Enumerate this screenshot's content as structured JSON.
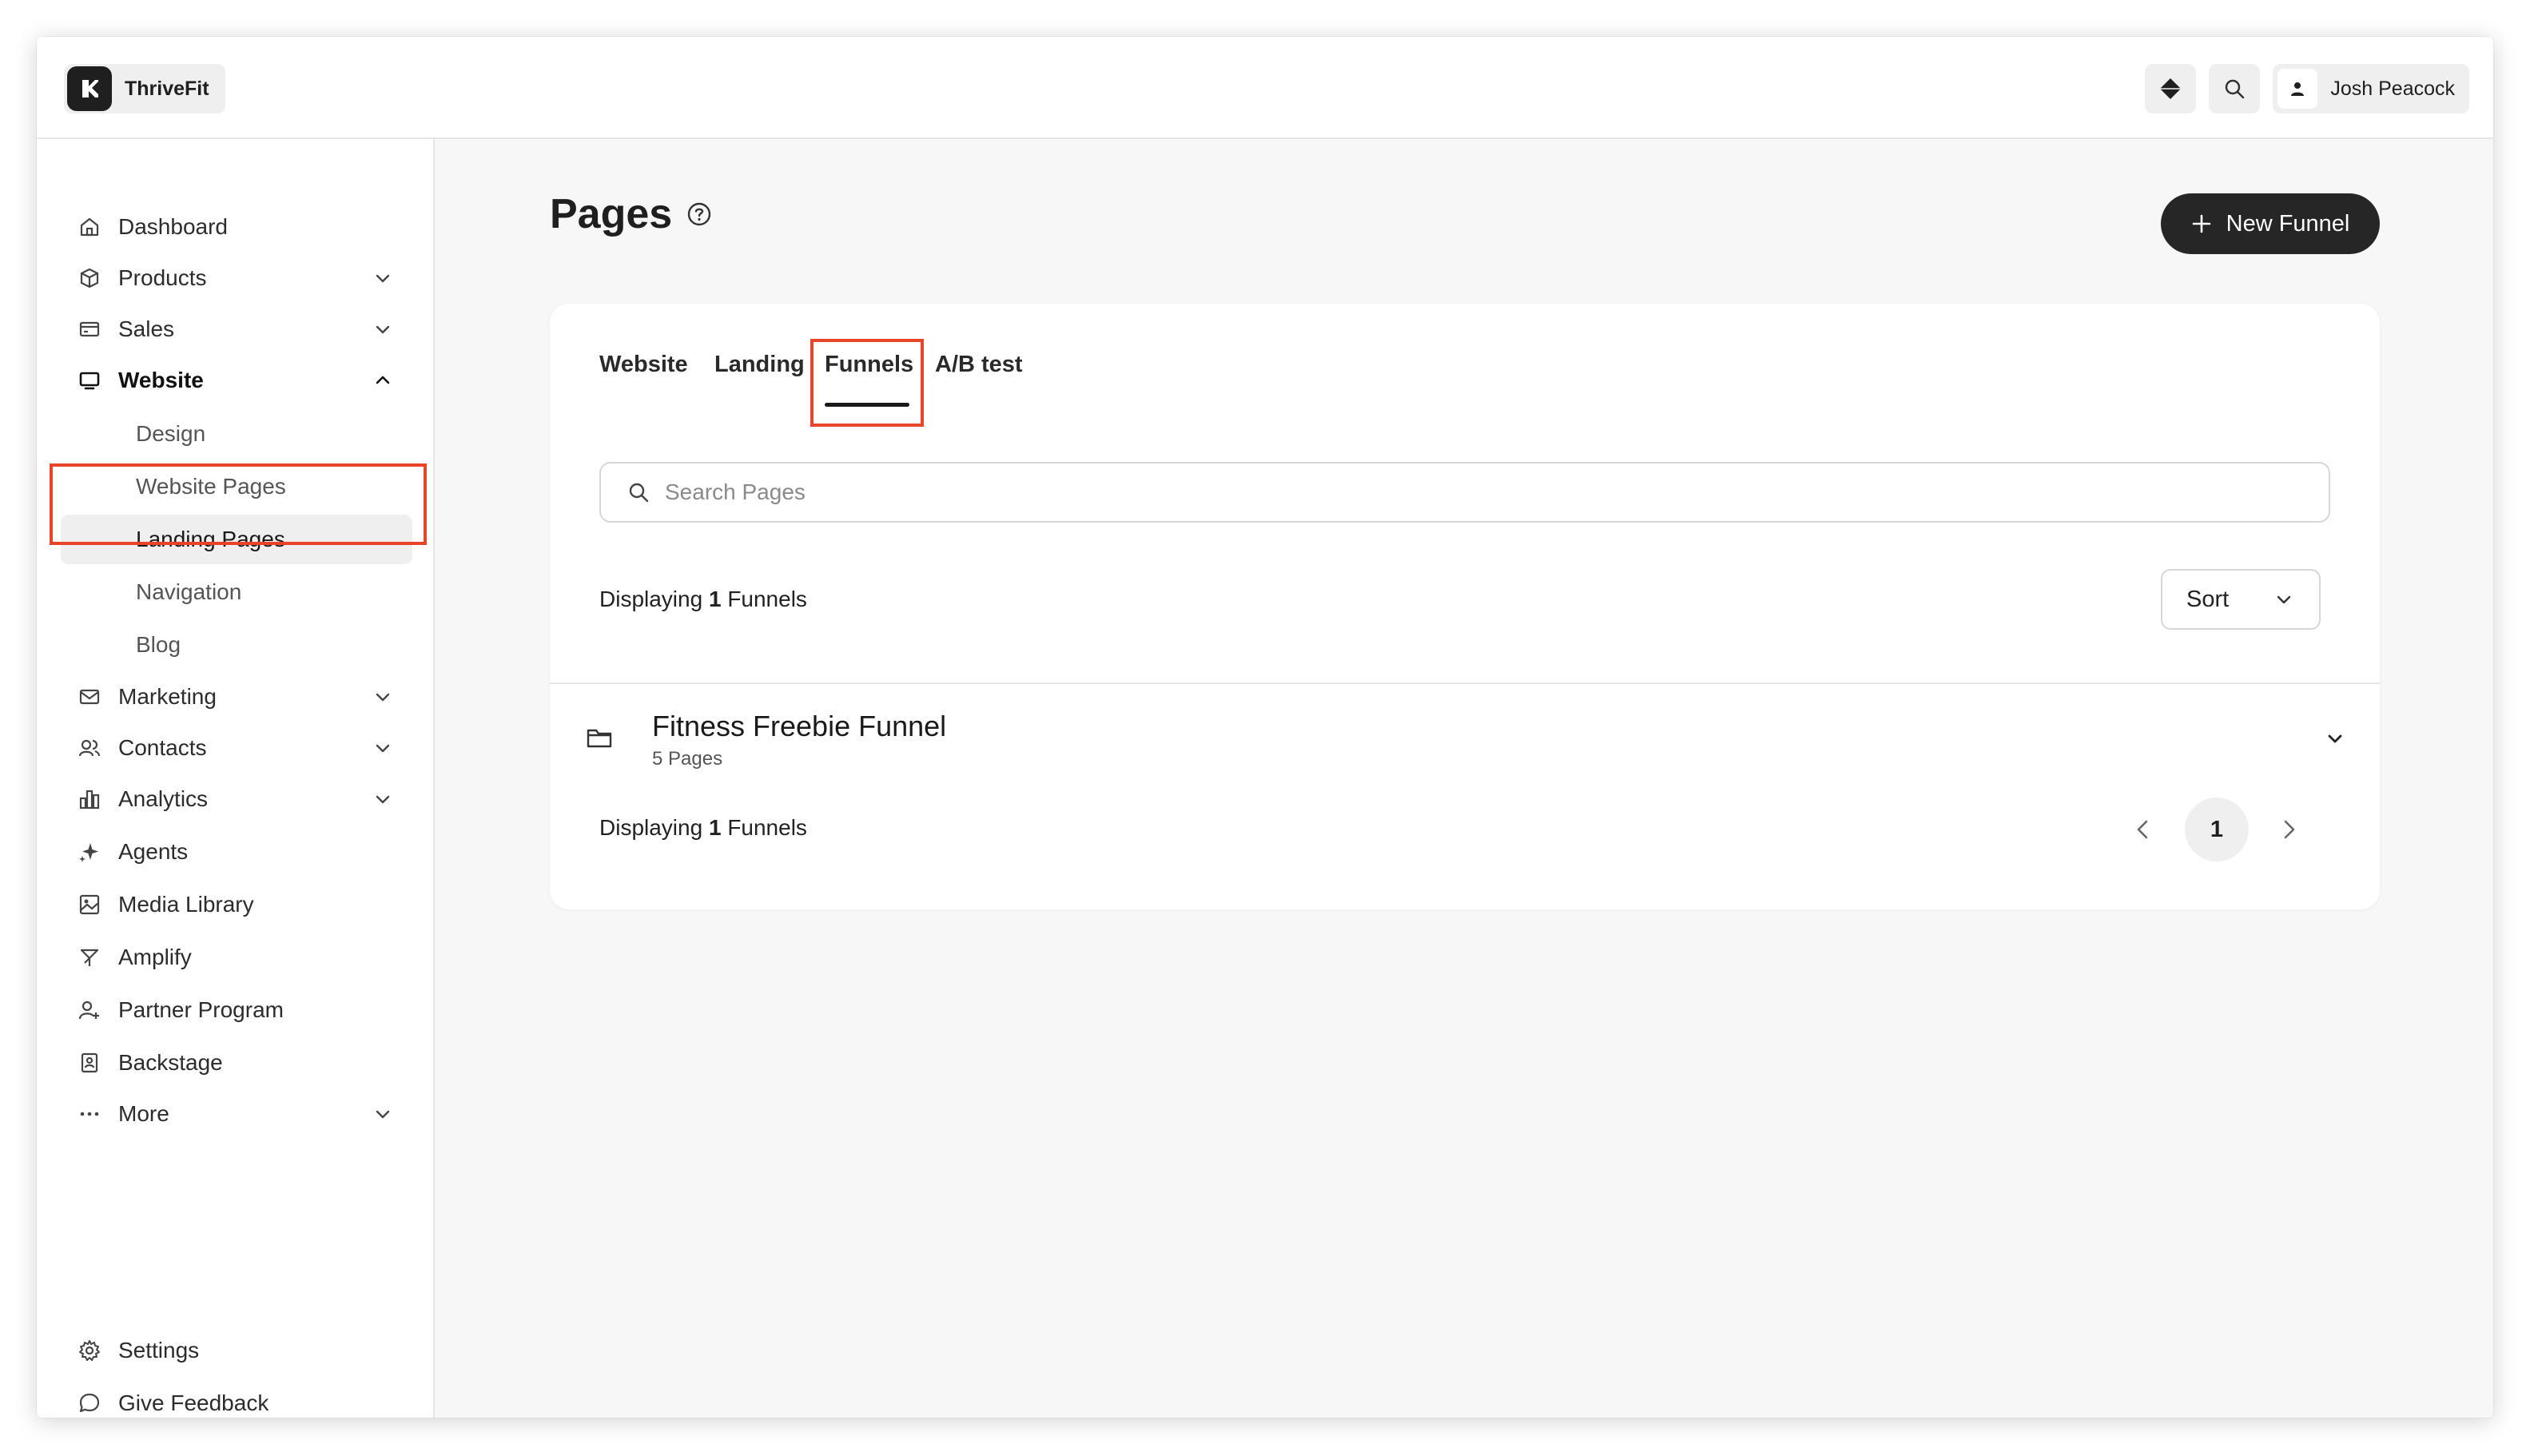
{
  "topbar": {
    "brand_name": "ThriveFit",
    "user_name": "Josh Peacock"
  },
  "sidebar": {
    "items": [
      {
        "label": "Dashboard",
        "icon": "home-icon"
      },
      {
        "label": "Products",
        "icon": "cube-icon"
      },
      {
        "label": "Sales",
        "icon": "card-icon"
      },
      {
        "label": "Website",
        "icon": "monitor-icon"
      },
      {
        "label": "Marketing",
        "icon": "mail-icon"
      },
      {
        "label": "Contacts",
        "icon": "users-icon"
      },
      {
        "label": "Analytics",
        "icon": "chart-icon"
      },
      {
        "label": "Agents",
        "icon": "sparkle-icon"
      },
      {
        "label": "Media Library",
        "icon": "image-icon"
      },
      {
        "label": "Amplify",
        "icon": "megaphone-icon"
      },
      {
        "label": "Partner Program",
        "icon": "partner-icon"
      },
      {
        "label": "Backstage",
        "icon": "backstage-icon"
      },
      {
        "label": "More",
        "icon": "more-icon"
      }
    ],
    "website_sub": [
      "Design",
      "Website Pages",
      "Landing Pages",
      "Navigation",
      "Blog"
    ],
    "settings": "Settings",
    "feedback": "Give Feedback"
  },
  "main": {
    "title": "Pages",
    "new_button": "New Funnel",
    "tabs": [
      "Website",
      "Landing",
      "Funnels",
      "A/B test"
    ],
    "active_tab": "Funnels",
    "search_placeholder": "Search Pages",
    "displaying_prefix": "Displaying",
    "displaying_count": "1",
    "displaying_suffix": "Funnels",
    "sort_label": "Sort",
    "funnel": {
      "name": "Fitness Freebie Funnel",
      "pages": "5 Pages"
    },
    "current_page": "1"
  },
  "colors": {
    "highlight": "#e8442a",
    "primary_button": "#262626"
  }
}
